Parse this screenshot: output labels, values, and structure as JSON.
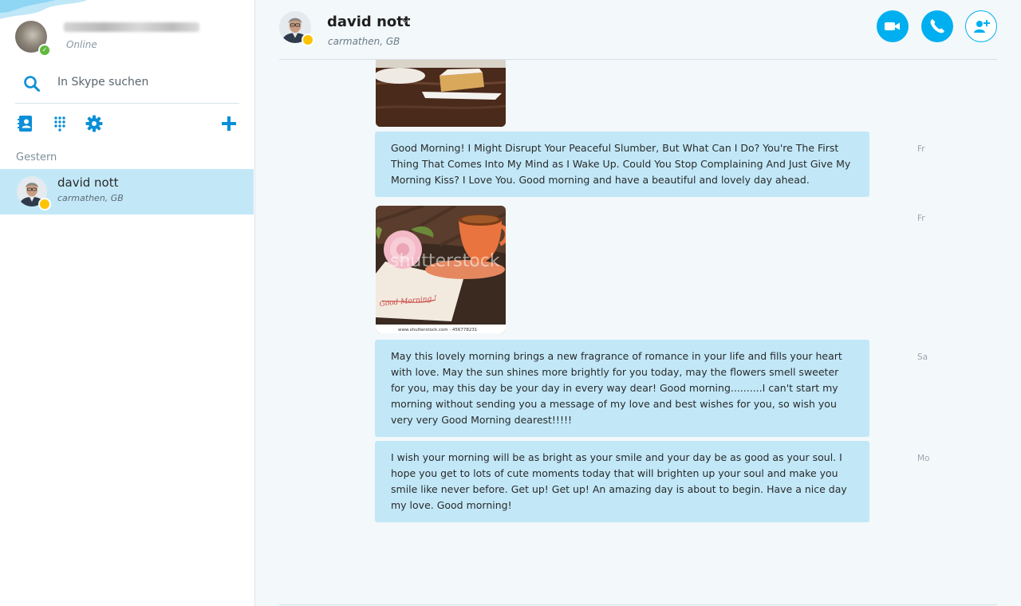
{
  "sidebar": {
    "me": {
      "status": "Online"
    },
    "search": {
      "placeholder": "In Skype suchen"
    },
    "toolbar": {
      "icons": [
        "contacts-book-icon",
        "dialpad-icon",
        "gear-icon",
        "plus-icon"
      ]
    },
    "section_label": "Gestern",
    "contacts": [
      {
        "name": "david nott",
        "location": "carmathen, GB",
        "status": "away"
      }
    ]
  },
  "header": {
    "name": "david nott",
    "location": "carmathen, GB",
    "buttons": [
      "video-call",
      "audio-call",
      "add-participant"
    ]
  },
  "colors": {
    "accent": "#00aff0",
    "bubble": "#c2e8f8",
    "online": "#5fb83b",
    "away": "#fcc300"
  },
  "messages": [
    {
      "type": "image",
      "image": "cake slice on plate"
    },
    {
      "type": "text",
      "text": "Good Morning! I Might Disrupt Your Peaceful Slumber, But What Can I Do? You're The First Thing That Comes Into My Mind as I Wake Up. Could You Stop Complaining And Just Give My Morning Kiss? I Love You. Good morning and have a beautiful and lovely day ahead.",
      "time": "Fr"
    },
    {
      "type": "image",
      "image": "coffee cup with rose and good morning card",
      "watermark": "shutterstock",
      "caption": "www.shutterstock.com · 456778231",
      "card_text": "Good Morning !",
      "time": "Fr"
    },
    {
      "type": "text",
      "text": "May this lovely morning brings a new fragrance of romance in your life and fills your heart with love. May the sun shines more brightly for you today, may the flowers smell sweeter for you, may this day be your day in every way dear! Good morning..........I can't start my morning without sending you a message of my love and best wishes for you, so wish you very very Good Morning dearest!!!!!",
      "time": "Sa"
    },
    {
      "type": "text",
      "text": "I wish your morning will be as bright as your smile and your day be as good as your soul. I hope you get to lots of cute moments today that will brighten up your soul and make you smile like never before. Get up! Get up! An amazing day is about to begin. Have a nice day my love. Good morning!",
      "time": "Mo"
    }
  ]
}
